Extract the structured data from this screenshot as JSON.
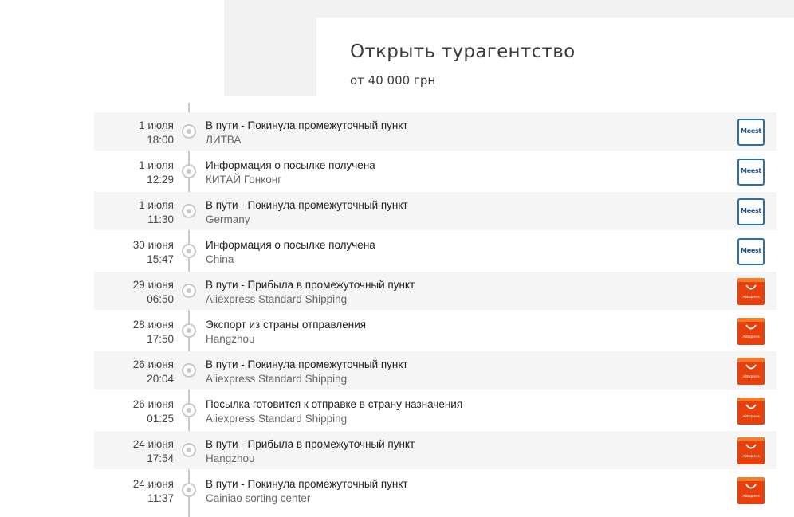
{
  "ad": {
    "title": "Открыть турагентство",
    "price": "от 40 000 грн"
  },
  "tracking": [
    {
      "date": "1 июля",
      "time": "18:00",
      "status": "В пути - Покинула промежуточный пункт",
      "place": "ЛИТВА",
      "carrier": "meest",
      "carrier_label": "Meest"
    },
    {
      "date": "1 июля",
      "time": "12:29",
      "status": "Информация о посылке получена",
      "place": "КИТАЙ Гонконг",
      "carrier": "meest",
      "carrier_label": "Meest"
    },
    {
      "date": "1 июля",
      "time": "11:30",
      "status": "В пути - Покинула промежуточный пункт",
      "place": "Germany",
      "carrier": "meest",
      "carrier_label": "Meest"
    },
    {
      "date": "30 июня",
      "time": "15:47",
      "status": "Информация о посылке получена",
      "place": "China",
      "carrier": "meest",
      "carrier_label": "Meest"
    },
    {
      "date": "29 июня",
      "time": "06:50",
      "status": "В пути - Прибыла в промежуточный пункт",
      "place": "Aliexpress Standard Shipping",
      "carrier": "aliexpress",
      "carrier_label": "AliExpress"
    },
    {
      "date": "28 июня",
      "time": "17:50",
      "status": "Экспорт из страны отправления",
      "place": "Hangzhou",
      "carrier": "aliexpress",
      "carrier_label": "AliExpress"
    },
    {
      "date": "26 июня",
      "time": "20:04",
      "status": "В пути - Покинула промежуточный пункт",
      "place": "Aliexpress Standard Shipping",
      "carrier": "aliexpress",
      "carrier_label": "AliExpress"
    },
    {
      "date": "26 июня",
      "time": "01:25",
      "status": "Посылка готовится к отправке в страну назначения",
      "place": "Aliexpress Standard Shipping",
      "carrier": "aliexpress",
      "carrier_label": "AliExpress"
    },
    {
      "date": "24 июня",
      "time": "17:54",
      "status": "В пути - Прибыла в промежуточный пункт",
      "place": "Hangzhou",
      "carrier": "aliexpress",
      "carrier_label": "AliExpress"
    },
    {
      "date": "24 июня",
      "time": "11:37",
      "status": "В пути - Покинула промежуточный пункт",
      "place": "Cainiao sorting center",
      "carrier": "aliexpress",
      "carrier_label": "AliExpress"
    }
  ]
}
